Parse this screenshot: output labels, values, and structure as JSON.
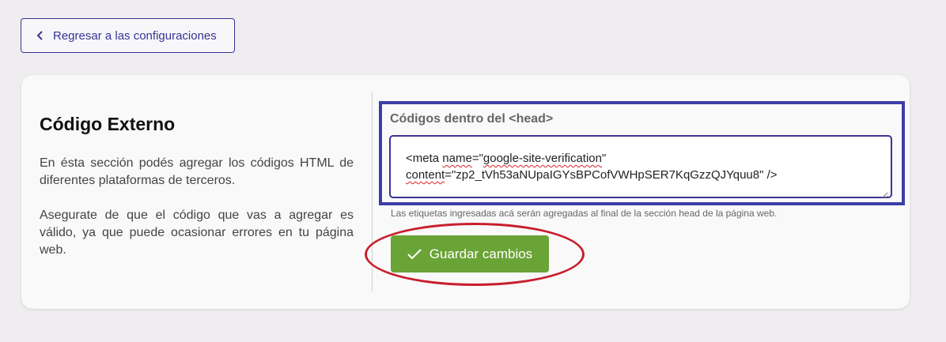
{
  "header": {
    "back_label": "Regresar a las configuraciones"
  },
  "section": {
    "title": "Código Externo",
    "description_1": "En ésta sección podés agregar los códigos HTML de diferentes plataformas de terceros.",
    "description_2": "Asegurate de que el código que vas a agregar es válido, ya que puede ocasionar errores en tu página web."
  },
  "head_codes": {
    "label": "Códigos dentro del <head>",
    "value_line1_a": "<meta ",
    "value_line1_b": "name",
    "value_line1_c": "=\"",
    "value_line1_d": "google-site-verification",
    "value_line1_e": "\"",
    "value_line2_a": "content",
    "value_line2_b": "=\"zp2_tVh53aNUpaIGYsBPCofVWHpSER7KqGzzQJYquu8\" />",
    "help": "Las etiquetas ingresadas acá serán agregadas al final de la sección head de la página web."
  },
  "actions": {
    "save_label": "Guardar cambios"
  },
  "colors": {
    "accent": "#3a3495",
    "save": "#6aa336",
    "annotation": "#c81e2c"
  },
  "icons": {
    "back": "chevron-left-icon",
    "save": "check-icon",
    "resize": "resize-grip-icon"
  }
}
